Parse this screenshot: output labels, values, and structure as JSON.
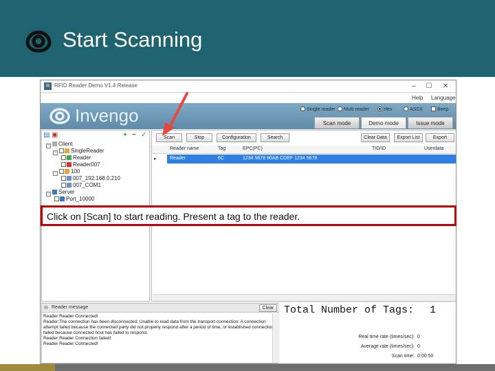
{
  "slide": {
    "title": "Start Scanning",
    "callout": "Click on [Scan] to start reading.  Present a tag to the reader.",
    "colors": {
      "banner": "#1f6270",
      "callout_border": "#c00000",
      "arrow": "#e8473f"
    }
  },
  "app": {
    "window_title": "RFID Reader Demo V1.4 Release",
    "brand": "Invengo",
    "menu": [
      "Help",
      "Language"
    ],
    "reader_modes": [
      {
        "label": "Single reader",
        "selected": false
      },
      {
        "label": "Multi reader",
        "selected": false
      }
    ],
    "encodings": [
      {
        "label": "Hex",
        "selected": true
      },
      {
        "label": "ASCII",
        "selected": false
      }
    ],
    "beep_label": "Beep",
    "mode_tabs": [
      {
        "label": "Scan mode",
        "active": false
      },
      {
        "label": "Demo mode",
        "active": true
      },
      {
        "label": "Issue mode",
        "active": false
      }
    ],
    "tree": [
      "Client",
      "SingleReader",
      "Reader",
      "Reader007",
      "100",
      "007_192.168.0.210",
      "007_COM1",
      "Server",
      "Port_10000"
    ],
    "operation_buttons_left": [
      "Scan",
      "Stop",
      "Configuration",
      "Search"
    ],
    "operation_buttons_right": [
      "Clear Data",
      "Export List",
      "Export"
    ],
    "grid_columns": [
      "Reader name",
      "Tag",
      "EPC(PC)",
      "TID/ID",
      "Userdata"
    ],
    "grid_rows": [
      {
        "reader": "Reader",
        "tag": "6C",
        "epc": "1234 5678 90AB CDEF 1234 5678",
        "tid": "",
        "user": ""
      }
    ],
    "log_title": "Reader message",
    "clear_label": "Clear",
    "log_lines": [
      "Reader Reader Connected!",
      "Reader:The connection has been disconnected. Unable to read data from the transport connection: A connection",
      "attempt failed because the connected party did not properly respond after a period of time, or established connection",
      "failed because connected host has failed to respond.",
      "Reader Reader Connection failed!",
      "Reader Reader Connected!"
    ],
    "total_label": "Total Number of Tags:",
    "total_value": "1",
    "stats": [
      {
        "label": "Real time rate (times/sec):",
        "value": "0"
      },
      {
        "label": "Average rate (times/sec):",
        "value": "0"
      },
      {
        "label": "Scan time:",
        "value": "0:00:50"
      }
    ]
  }
}
